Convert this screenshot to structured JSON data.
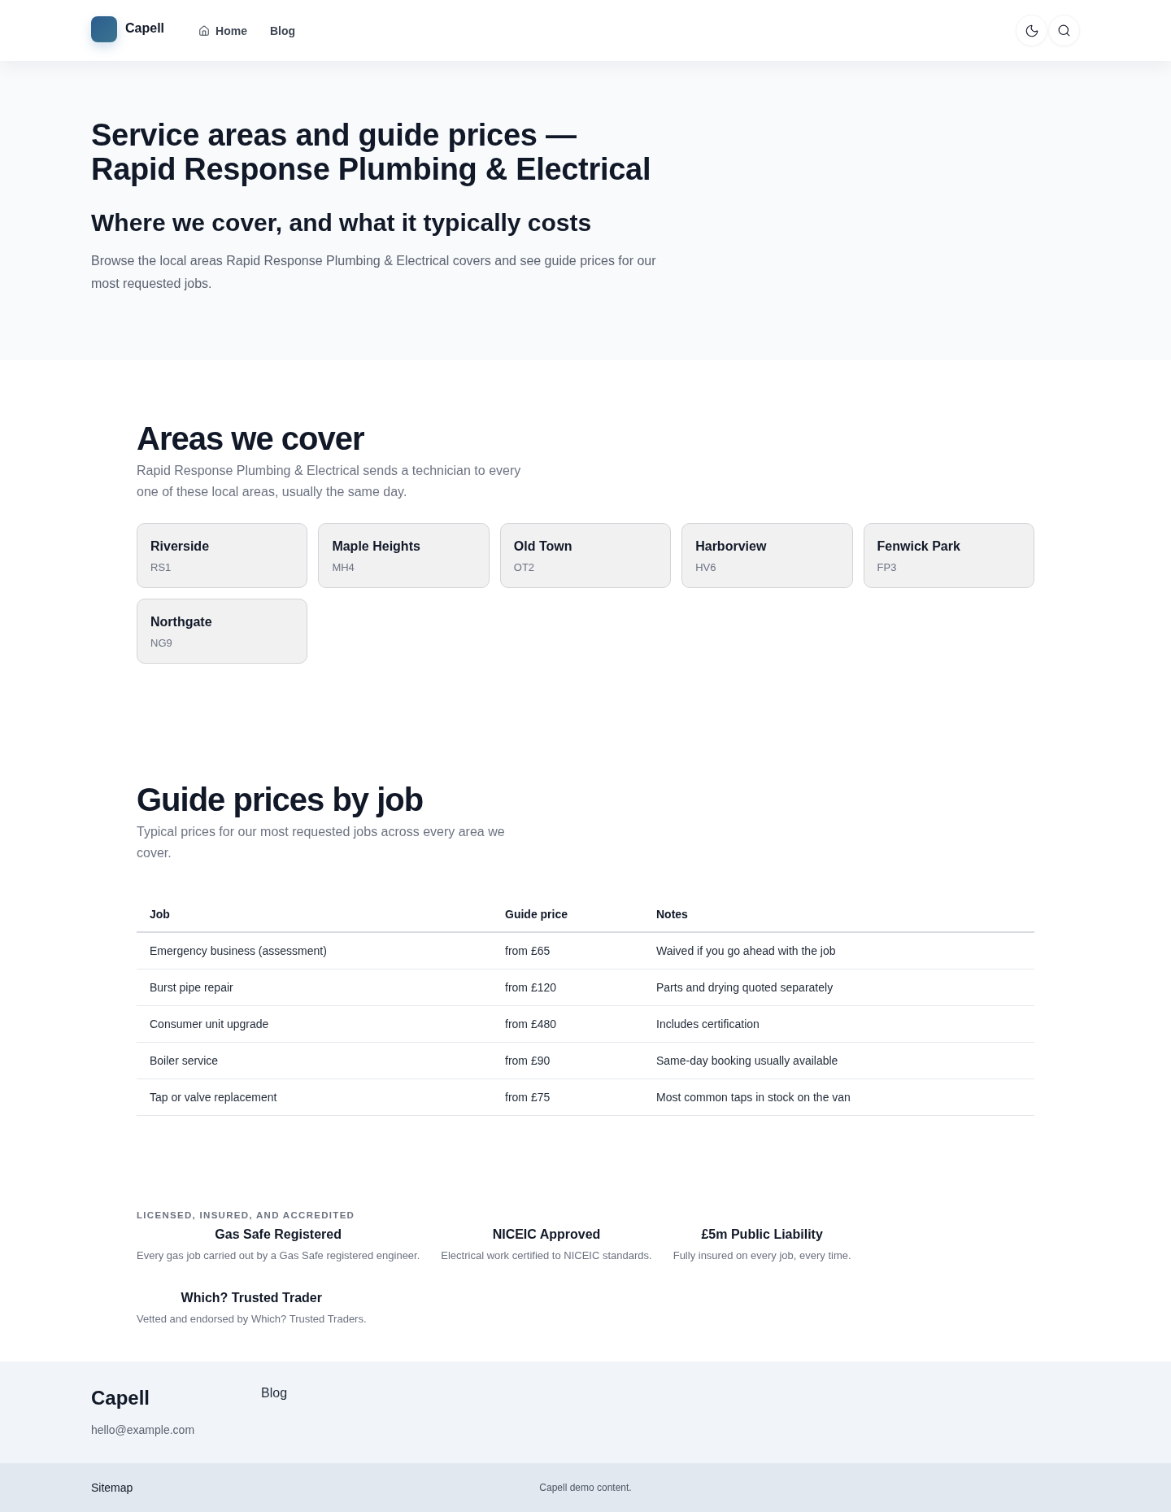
{
  "header": {
    "brand": "Capell",
    "nav": [
      {
        "label": "Home",
        "kind": "home"
      },
      {
        "label": "Blog",
        "kind": "link"
      }
    ]
  },
  "hero": {
    "title": "Service areas and guide prices — Rapid Response Plumbing & Electrical",
    "subtitle": "Where we cover, and what it typically costs",
    "intro": "Browse the local areas Rapid Response Plumbing & Electrical covers and see guide prices for our most requested jobs."
  },
  "areas": {
    "title": "Areas we cover",
    "description": "Rapid Response Plumbing & Electrical sends a technician to every one of these local areas, usually the same day.",
    "items": [
      {
        "name": "Riverside",
        "code": "RS1"
      },
      {
        "name": "Maple Heights",
        "code": "MH4"
      },
      {
        "name": "Old Town",
        "code": "OT2"
      },
      {
        "name": "Harborview",
        "code": "HV6"
      },
      {
        "name": "Fenwick Park",
        "code": "FP3"
      },
      {
        "name": "Northgate",
        "code": "NG9"
      }
    ]
  },
  "prices": {
    "title": "Guide prices by job",
    "description": "Typical prices for our most requested jobs across every area we cover.",
    "table": {
      "columns": [
        "Job",
        "Guide price",
        "Notes"
      ],
      "rows": [
        [
          "Emergency business (assessment)",
          "from £65",
          "Waived if you go ahead with the job"
        ],
        [
          "Burst pipe repair",
          "from £120",
          "Parts and drying quoted separately"
        ],
        [
          "Consumer unit upgrade",
          "from £480",
          "Includes certification"
        ],
        [
          "Boiler service",
          "from £90",
          "Same-day booking usually available"
        ],
        [
          "Tap or valve replacement",
          "from £75",
          "Most common taps in stock on the van"
        ]
      ]
    }
  },
  "accreditations": {
    "heading": "LICENSED, INSURED, AND ACCREDITED",
    "items": [
      {
        "title": "Gas Safe Registered",
        "description": "Every gas job carried out by a Gas Safe registered engineer."
      },
      {
        "title": "NICEIC Approved",
        "description": "Electrical work certified to NICEIC standards."
      },
      {
        "title": "£5m Public Liability",
        "description": "Fully insured on every job, every time."
      },
      {
        "title": "Which? Trusted Trader",
        "description": "Vetted and endorsed by Which? Trusted Traders."
      }
    ]
  },
  "footer": {
    "brand": "Capell",
    "email": "hello@example.com",
    "links": [
      "Blog"
    ],
    "bottom_link": "Sitemap",
    "note": "Capell demo content."
  }
}
